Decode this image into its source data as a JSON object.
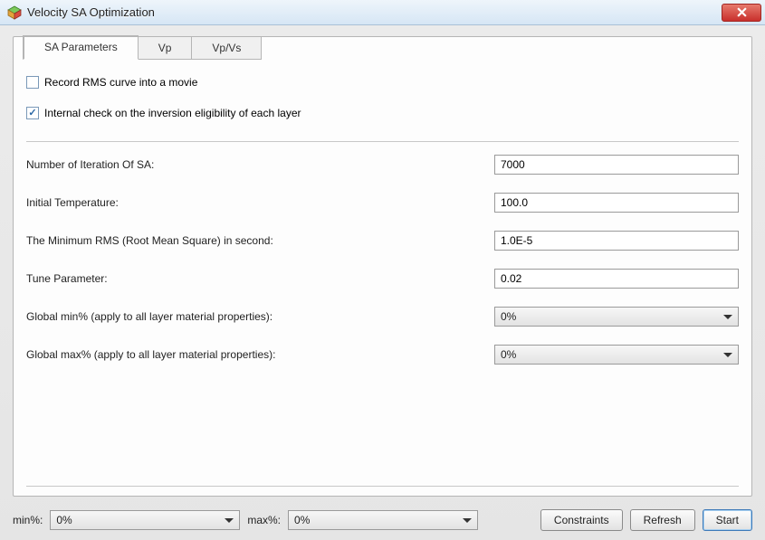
{
  "window": {
    "title": "Velocity SA Optimization"
  },
  "tabs": [
    {
      "label": "SA Parameters",
      "active": true
    },
    {
      "label": "Vp",
      "active": false
    },
    {
      "label": "Vp/Vs",
      "active": false
    }
  ],
  "checks": {
    "record_rms": {
      "label": "Record RMS curve into a movie",
      "checked": false
    },
    "internal_check": {
      "label": "Internal check on the inversion eligibility of each layer",
      "checked": true
    }
  },
  "fields": {
    "iterations": {
      "label": "Number of Iteration Of SA:",
      "value": "7000"
    },
    "initial_temp": {
      "label": "Initial Temperature:",
      "value": "100.0"
    },
    "min_rms": {
      "label": "The Minimum RMS (Root Mean Square) in second:",
      "value": "1.0E-5"
    },
    "tune_param": {
      "label": "Tune Parameter:",
      "value": "0.02"
    },
    "global_min": {
      "label": "Global min% (apply to all layer material properties):",
      "value": "0%"
    },
    "global_max": {
      "label": "Global max% (apply to all layer material properties):",
      "value": "0%"
    }
  },
  "bottom": {
    "min_label": "min%:",
    "min_value": "0%",
    "max_label": "max%:",
    "max_value": "0%",
    "constraints": "Constraints",
    "refresh": "Refresh",
    "start": "Start"
  }
}
